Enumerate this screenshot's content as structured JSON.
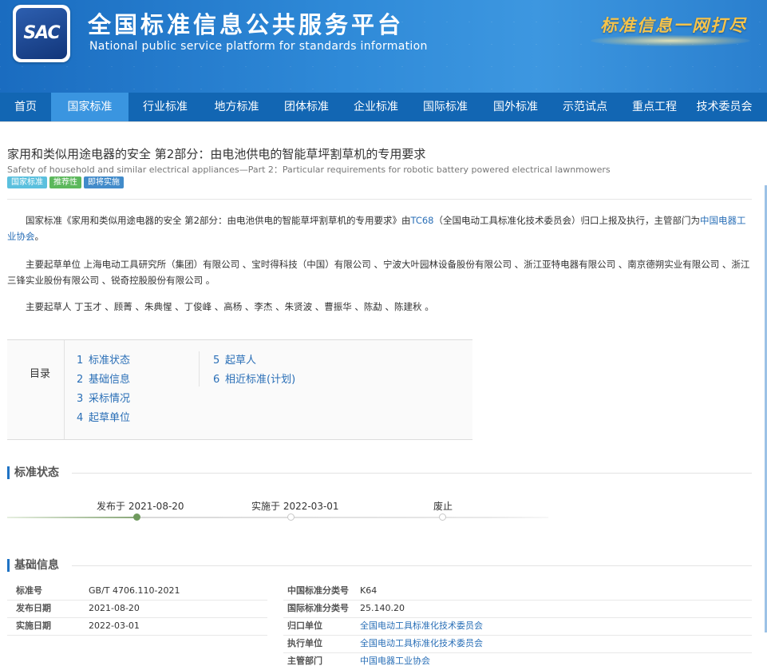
{
  "header": {
    "logo_text": "SAC",
    "site_title": "全国标准信息公共服务平台",
    "site_subtitle": "National public service platform  for standards information",
    "slogan": "标准信息一网打尽"
  },
  "nav": {
    "items": [
      {
        "label": "首页",
        "active": false
      },
      {
        "label": "国家标准",
        "active": true
      },
      {
        "label": "行业标准",
        "active": false
      },
      {
        "label": "地方标准",
        "active": false
      },
      {
        "label": "团体标准",
        "active": false
      },
      {
        "label": "企业标准",
        "active": false
      },
      {
        "label": "国际标准",
        "active": false
      },
      {
        "label": "国外标准",
        "active": false
      },
      {
        "label": "示范试点",
        "active": false
      },
      {
        "label": "重点工程",
        "active": false
      },
      {
        "label": "技术委员会",
        "active": false
      }
    ]
  },
  "standard": {
    "title_cn": "家用和类似用途电器的安全 第2部分：由电池供电的智能草坪割草机的专用要求",
    "title_en": "Safety of household and similar electrical appliances—Part 2：Particular requirements for robotic battery powered electrical lawnmowers",
    "tags": [
      {
        "label": "国家标准",
        "color": "#5bc0de"
      },
      {
        "label": "推荐性",
        "color": "#5cb85c"
      },
      {
        "label": "即将实施",
        "color": "#428bca"
      }
    ],
    "intro": {
      "p1_a": "国家标准《家用和类似用途电器的安全 第2部分：由电池供电的智能草坪割草机的专用要求》由",
      "p1_link1": "TC68",
      "p1_b": "（全国电动工具标准化技术委员会）归口上报及执行，主管部门为",
      "p1_link2": "中国电器工业协会",
      "p1_c": "。",
      "p2": "主要起草单位 上海电动工具研究所（集团）有限公司 、宝时得科技（中国）有限公司 、宁波大叶园林设备股份有限公司 、浙江亚特电器有限公司 、南京德朔实业有限公司 、浙江三锋实业股份有限公司 、锐奇控股股份有限公司 。",
      "p3": "主要起草人 丁玉才 、顾菁 、朱典惺 、丁俊峰 、高杨 、李杰 、朱贤波 、曹振华 、陈勐 、陈建秋 。"
    }
  },
  "toc": {
    "label": "目录",
    "col1": [
      {
        "num": "1",
        "label": "标准状态"
      },
      {
        "num": "2",
        "label": "基础信息"
      },
      {
        "num": "3",
        "label": "采标情况"
      },
      {
        "num": "4",
        "label": "起草单位"
      }
    ],
    "col2": [
      {
        "num": "5",
        "label": "起草人"
      },
      {
        "num": "6",
        "label": "相近标准(计划)"
      }
    ]
  },
  "status": {
    "heading": "标准状态",
    "timeline": [
      {
        "label": "发布于 2021-08-20",
        "done": true
      },
      {
        "label": "实施于 2022-03-01",
        "done": false
      },
      {
        "label": "废止",
        "done": false
      }
    ]
  },
  "basic": {
    "heading": "基础信息",
    "left": [
      {
        "label": "标准号",
        "value": "GB/T 4706.110-2021"
      },
      {
        "label": "发布日期",
        "value": "2021-08-20"
      },
      {
        "label": "实施日期",
        "value": "2022-03-01"
      }
    ],
    "right": [
      {
        "label": "中国标准分类号",
        "value": "K64",
        "link": false
      },
      {
        "label": "国际标准分类号",
        "value": "25.140.20",
        "link": false
      },
      {
        "label": "归口单位",
        "value": "全国电动工具标准化技术委员会",
        "link": true
      },
      {
        "label": "执行单位",
        "value": "全国电动工具标准化技术委员会",
        "link": true
      },
      {
        "label": "主管部门",
        "value": "中国电器工业协会",
        "link": true
      }
    ]
  },
  "colors": {
    "header_blue": "#1a6cc0",
    "nav_blue": "#1266b3",
    "nav_active": "#3a95e0",
    "link_blue": "#2a6fb7",
    "timeline_done": "#6f9a5e"
  }
}
